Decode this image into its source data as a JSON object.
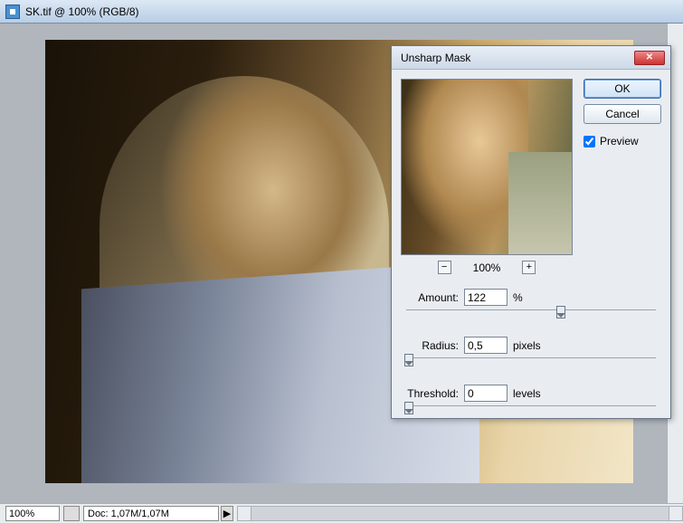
{
  "titlebar": {
    "text": "SK.tif @ 100% (RGB/8)"
  },
  "status": {
    "zoom": "100%",
    "doc": "Doc: 1,07M/1,07M",
    "arrow_glyph": "▶"
  },
  "dialog": {
    "title": "Unsharp Mask",
    "close_glyph": "✕",
    "ok_label": "OK",
    "cancel_label": "Cancel",
    "preview_label": "Preview",
    "preview_checked": true,
    "zoom": {
      "minus_glyph": "−",
      "plus_glyph": "+",
      "level": "100%"
    },
    "amount": {
      "label": "Amount:",
      "value": "122",
      "unit": "%",
      "slider_pct": 62
    },
    "radius": {
      "label": "Radius:",
      "value": "0,5",
      "unit": "pixels",
      "slider_pct": 1
    },
    "threshold": {
      "label": "Threshold:",
      "value": "0",
      "unit": "levels",
      "slider_pct": 1
    }
  }
}
